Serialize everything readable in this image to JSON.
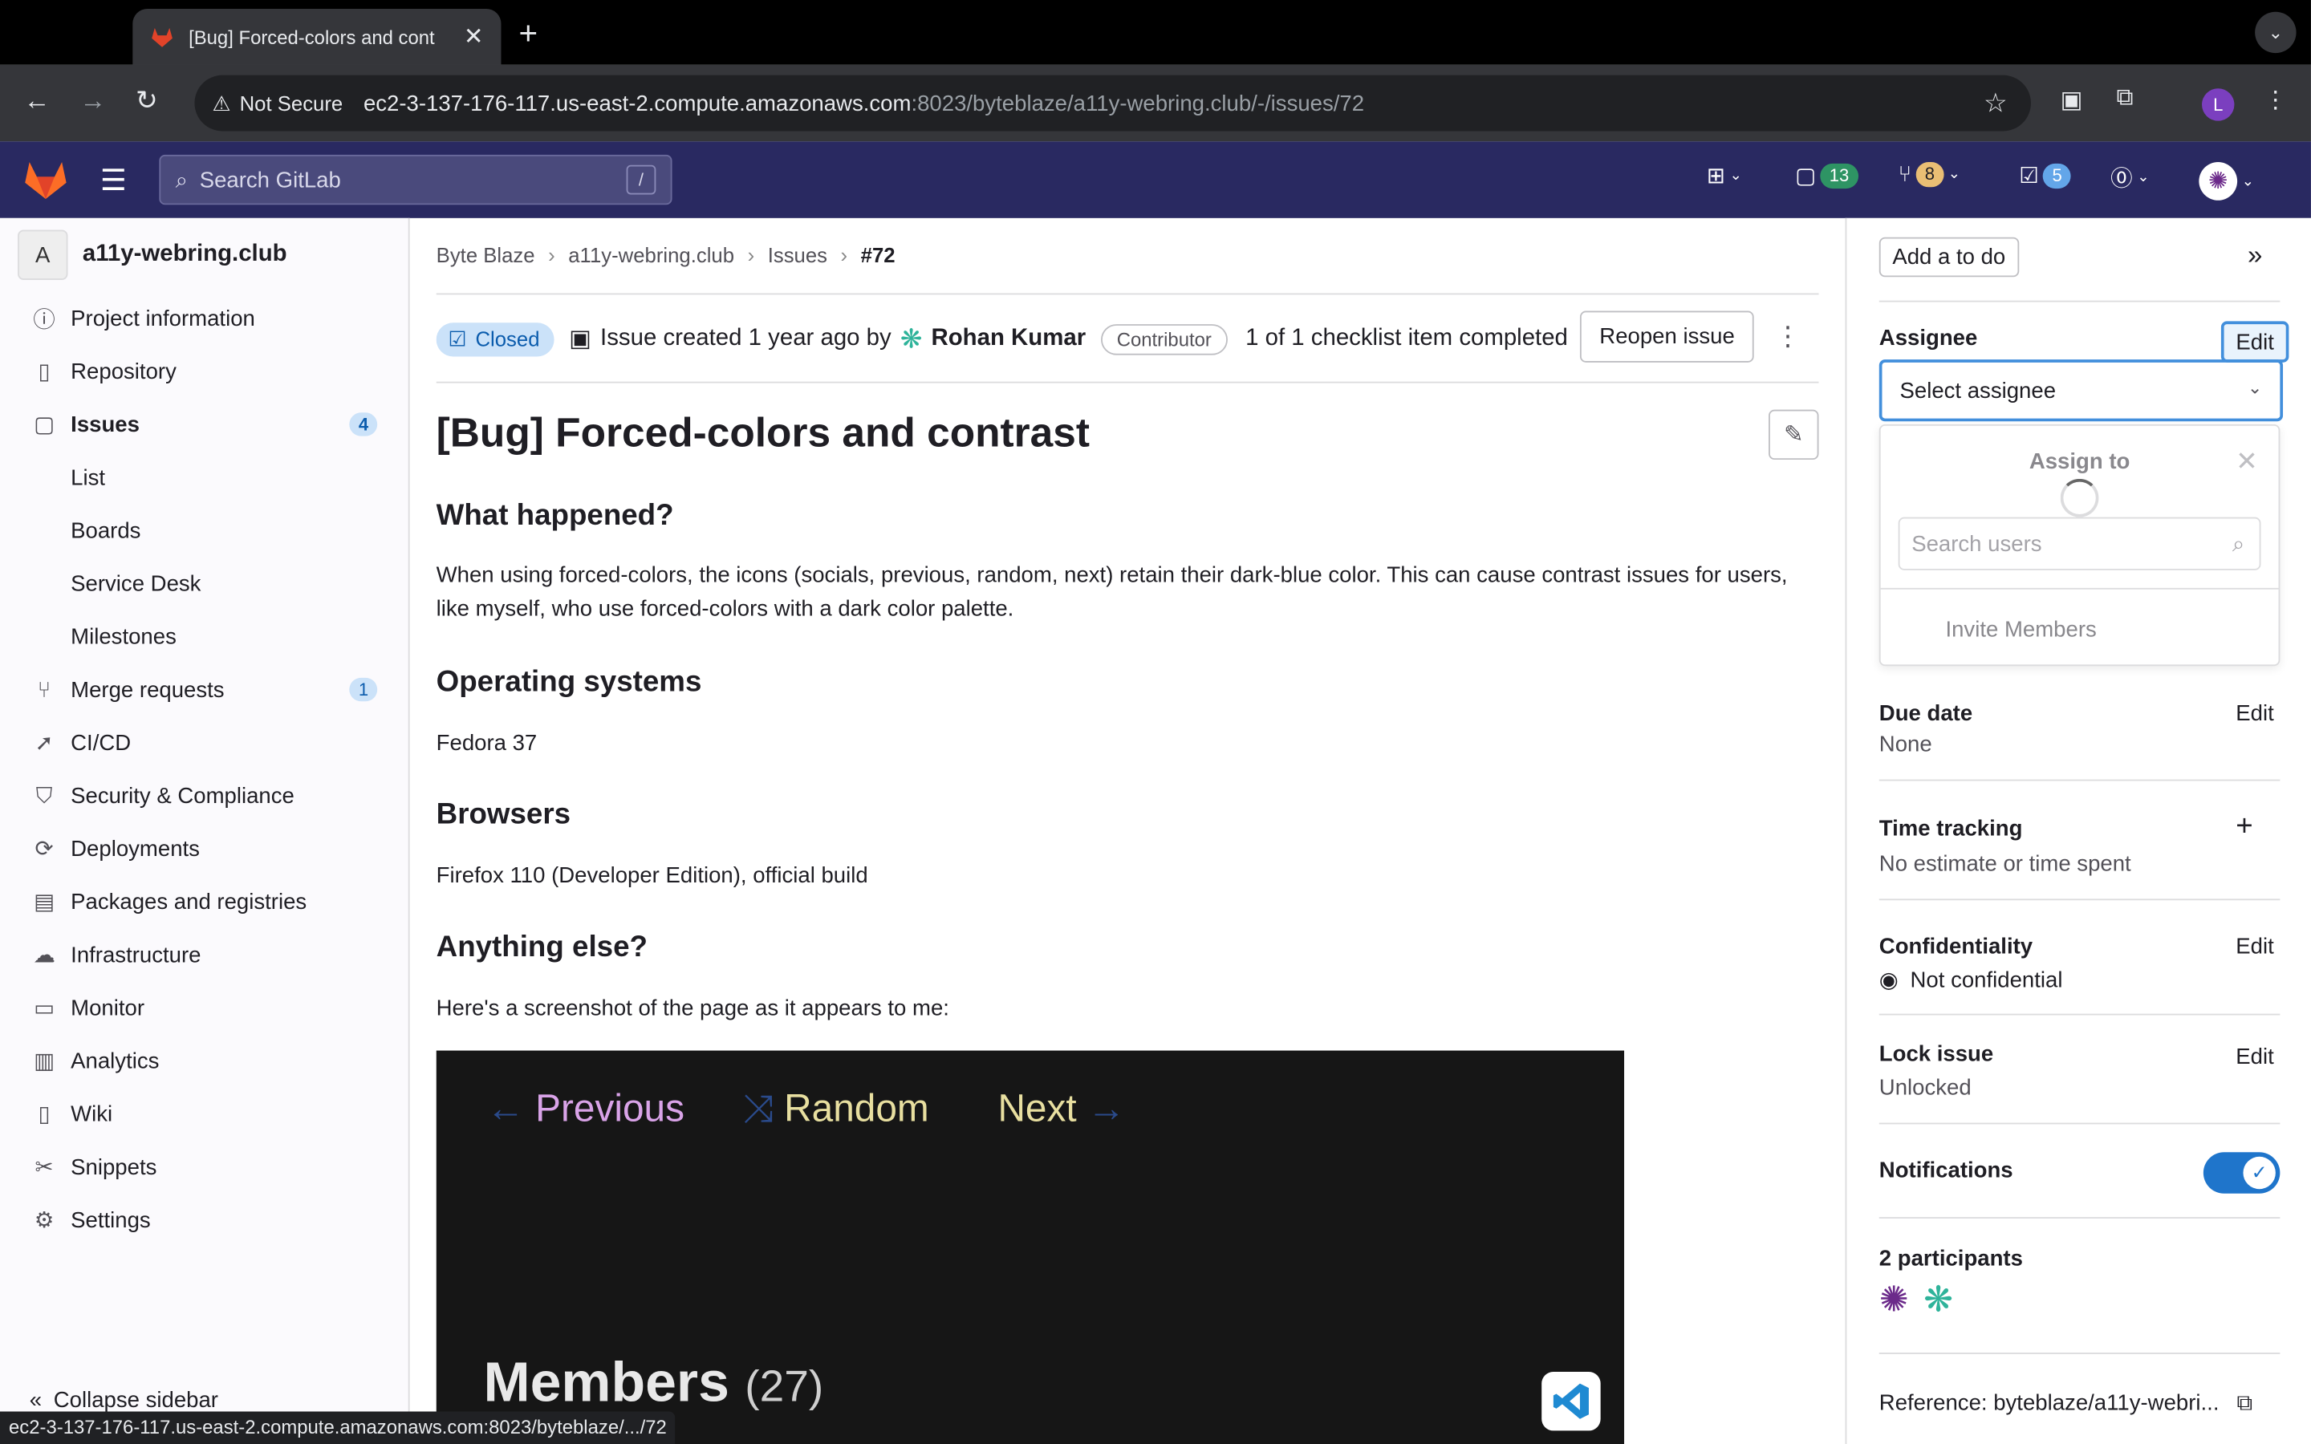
{
  "browser": {
    "tab_title": "[Bug] Forced-colors and cont",
    "new_tab": "+",
    "not_secure": "Not Secure",
    "url_host": "ec2-3-137-176-117.us-east-2.compute.amazonaws.com",
    "url_path": ":8023/byteblaze/a11y-webring.club/-/issues/72",
    "profile_initial": "L",
    "status_url": "ec2-3-137-176-117.us-east-2.compute.amazonaws.com:8023/byteblaze/.../72"
  },
  "gitlab_nav": {
    "search_placeholder": "Search GitLab",
    "search_shortcut": "/",
    "issues_count": "13",
    "mr_count": "8",
    "todo_count": "5"
  },
  "sidebar": {
    "project_initial": "A",
    "project_name": "a11y-webring.club",
    "items": [
      {
        "label": "Project information",
        "icon": "info-icon"
      },
      {
        "label": "Repository",
        "icon": "doc-icon"
      },
      {
        "label": "Issues",
        "icon": "issues-icon",
        "badge": "4"
      },
      {
        "label": "List"
      },
      {
        "label": "Boards"
      },
      {
        "label": "Service Desk"
      },
      {
        "label": "Milestones"
      },
      {
        "label": "Merge requests",
        "icon": "merge-request-icon",
        "badge": "1"
      },
      {
        "label": "CI/CD",
        "icon": "rocket-icon"
      },
      {
        "label": "Security & Compliance",
        "icon": "shield-icon"
      },
      {
        "label": "Deployments",
        "icon": "deployments-icon"
      },
      {
        "label": "Packages and registries",
        "icon": "package-icon"
      },
      {
        "label": "Infrastructure",
        "icon": "cloud-icon"
      },
      {
        "label": "Monitor",
        "icon": "monitor-icon"
      },
      {
        "label": "Analytics",
        "icon": "chart-icon"
      },
      {
        "label": "Wiki",
        "icon": "book-icon"
      },
      {
        "label": "Snippets",
        "icon": "scissors-icon"
      },
      {
        "label": "Settings",
        "icon": "gear-icon"
      }
    ],
    "collapse": "Collapse sidebar"
  },
  "breadcrumb": [
    "Byte Blaze",
    "a11y-webring.club",
    "Issues",
    "#72"
  ],
  "issue": {
    "status": "Closed",
    "created": "Issue created 1 year ago by",
    "author": "Rohan Kumar",
    "author_role": "Contributor",
    "checklist": "1 of 1 checklist item completed",
    "reopen": "Reopen issue",
    "title": "[Bug] Forced-colors and contrast",
    "sections": [
      {
        "heading": "What happened?",
        "body": "When using forced-colors, the icons (socials, previous, random, next) retain their dark-blue color. This can cause contrast issues for users, like myself, who use forced-colors with a dark color palette."
      },
      {
        "heading": "Operating systems",
        "body": "Fedora 37"
      },
      {
        "heading": "Browsers",
        "body": "Firefox 110 (Developer Edition), official build"
      },
      {
        "heading": "Anything else?",
        "body": "Here's a screenshot of the page as it appears to me:"
      }
    ],
    "screenshot": {
      "previous": "Previous",
      "random": "Random",
      "next": "Next",
      "members": "Members",
      "members_count": "(27)",
      "previous_color": "#d9a3e8",
      "random_color": "#e8dfa0",
      "next_color": "#e8dfa0"
    }
  },
  "right": {
    "add_todo": "Add a to do",
    "assignee_label": "Assignee",
    "edit": "Edit",
    "select_assignee": "Select assignee",
    "assign_to": "Assign to",
    "search_users": "Search users",
    "invite_members": "Invite Members",
    "due_date_label": "Due date",
    "due_date_value": "None",
    "time_tracking_label": "Time tracking",
    "time_tracking_value": "No estimate or time spent",
    "confidentiality_label": "Confidentiality",
    "confidentiality_value": "Not confidential",
    "lock_label": "Lock issue",
    "lock_value": "Unlocked",
    "notifications_label": "Notifications",
    "participants_label": "2 participants",
    "reference": "Reference: byteblaze/a11y-webri..."
  },
  "colors": {
    "gitlab_nav": "#292961",
    "accent_blue": "#1f75cb",
    "closed_badge_bg": "#cbe2f9"
  }
}
